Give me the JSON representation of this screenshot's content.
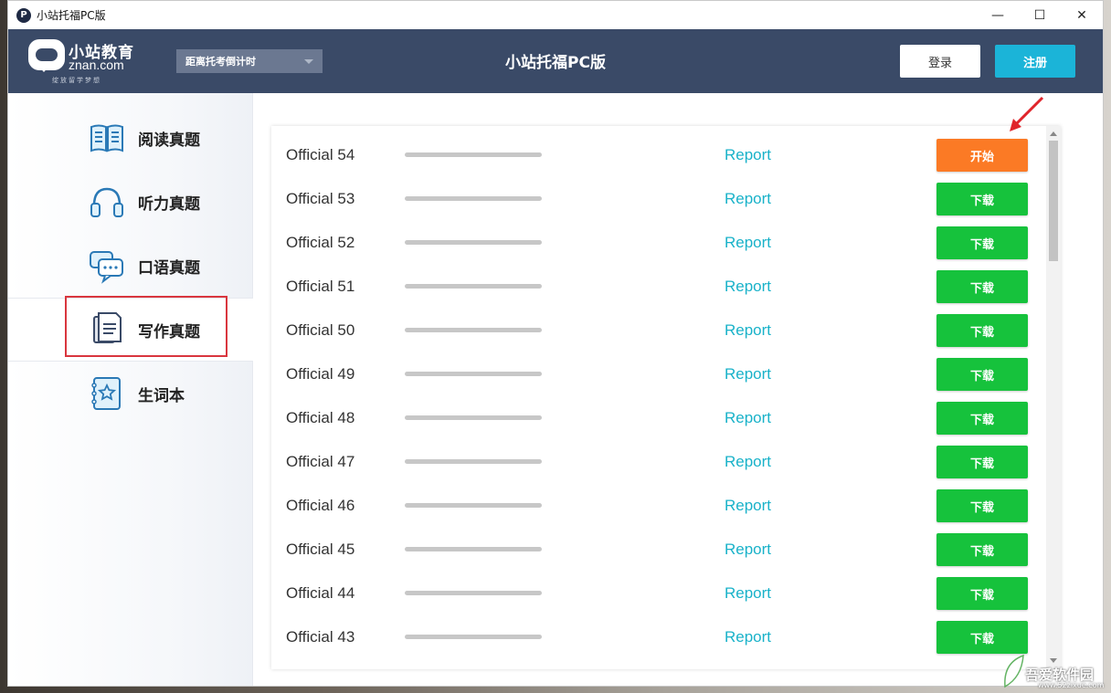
{
  "window": {
    "title": "小站托福PC版",
    "icon_letter": "P",
    "minimize": "—",
    "maximize": "☐",
    "close": "✕"
  },
  "header": {
    "logo_name": "小站教育",
    "logo_domain": "znan.com",
    "logo_slogan": "绽放留学梦想",
    "countdown_label": "距离托考倒计时",
    "title": "小站托福PC版",
    "login_label": "登录",
    "register_label": "注册",
    "colors": {
      "header_bg": "#3a4a67",
      "register_bg": "#1bb4d8"
    }
  },
  "sidebar": {
    "items": [
      {
        "label": "阅读真题",
        "icon": "book-icon"
      },
      {
        "label": "听力真题",
        "icon": "headphones-icon"
      },
      {
        "label": "口语真题",
        "icon": "chat-bubbles-icon"
      },
      {
        "label": "写作真题",
        "icon": "document-icon",
        "active": true
      },
      {
        "label": "生词本",
        "icon": "notebook-star-icon"
      }
    ]
  },
  "list": {
    "report_label": "Report",
    "rows": [
      {
        "name": "Official 54",
        "action": "开始",
        "action_color": "#fb7a25"
      },
      {
        "name": "Official 53",
        "action": "下载",
        "action_color": "#16c23c"
      },
      {
        "name": "Official 52",
        "action": "下载",
        "action_color": "#16c23c"
      },
      {
        "name": "Official 51",
        "action": "下载",
        "action_color": "#16c23c"
      },
      {
        "name": "Official 50",
        "action": "下载",
        "action_color": "#16c23c"
      },
      {
        "name": "Official 49",
        "action": "下载",
        "action_color": "#16c23c"
      },
      {
        "name": "Official 48",
        "action": "下载",
        "action_color": "#16c23c"
      },
      {
        "name": "Official 47",
        "action": "下载",
        "action_color": "#16c23c"
      },
      {
        "name": "Official 46",
        "action": "下载",
        "action_color": "#16c23c"
      },
      {
        "name": "Official 45",
        "action": "下载",
        "action_color": "#16c23c"
      },
      {
        "name": "Official 44",
        "action": "下载",
        "action_color": "#16c23c"
      },
      {
        "name": "Official 43",
        "action": "下载",
        "action_color": "#16c23c"
      }
    ]
  },
  "watermark": {
    "site_name": "吾爱软件园",
    "site_url": "www.52zixue.com"
  }
}
